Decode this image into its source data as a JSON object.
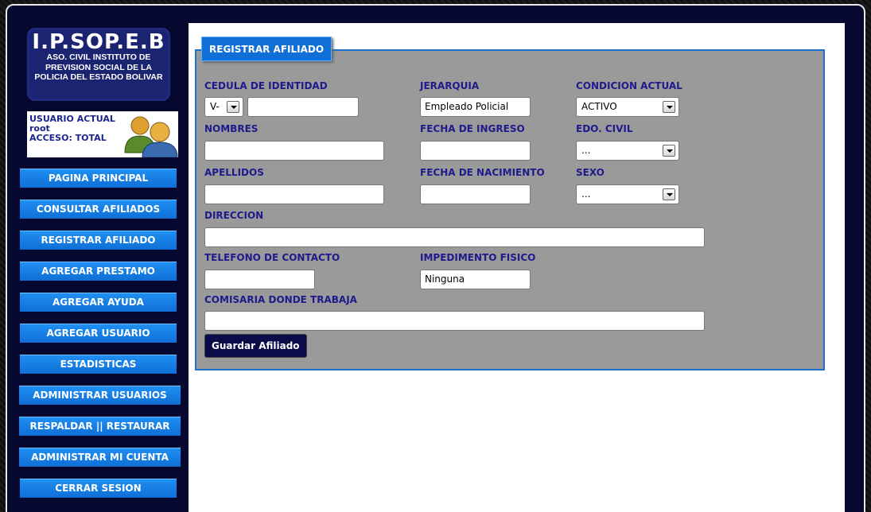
{
  "logo": {
    "title": "I.P.SOP.E.B",
    "line1": "ASO. CIVIL INSTITUTO DE",
    "line2": "PREVISION SOCIAL DE LA",
    "line3": "POLICIA DEL ESTADO BOLIVAR"
  },
  "user": {
    "label": "USUARIO ACTUAL",
    "name": "root",
    "access": "ACCESO: TOTAL"
  },
  "menu": [
    "PAGINA PRINCIPAL",
    "CONSULTAR AFILIADOS",
    "REGISTRAR AFILIADO",
    "AGREGAR PRESTAMO",
    "AGREGAR AYUDA",
    "AGREGAR USUARIO",
    "ESTADISTICAS",
    "ADMINISTRAR USUARIOS",
    "RESPALDAR || RESTAURAR",
    "ADMINISTRAR MI CUENTA",
    "CERRAR SESION"
  ],
  "form": {
    "title": "REGISTRAR AFILIADO",
    "cedula_label": "CEDULA DE IDENTIDAD",
    "cedula_prefix": "V-",
    "cedula_value": "",
    "jerarquia_label": "JERARQUIA",
    "jerarquia_value": "Empleado Policial",
    "condicion_label": "CONDICION ACTUAL",
    "condicion_value": "ACTIVO",
    "nombres_label": "NOMBRES",
    "fecha_ingreso_label": "FECHA DE INGRESO",
    "edo_civil_label": "EDO. CIVIL",
    "edo_civil_value": "...",
    "apellidos_label": "APELLIDOS",
    "fecha_nac_label": "FECHA DE NACIMIENTO",
    "sexo_label": "SEXO",
    "sexo_value": "...",
    "direccion_label": "DIRECCION",
    "telefono_label": "TELEFONO DE CONTACTO",
    "impedimento_label": "IMPEDIMENTO FISICO",
    "impedimento_value": "Ninguna",
    "comisaria_label": "COMISARIA DONDE TRABAJA",
    "save_label": "Guardar Afiliado"
  },
  "colors": {
    "frame_bg": "#070830",
    "menu_button": "#0f6fd6",
    "panel_bg": "#9a9a9a",
    "label_text": "#1f1a8c",
    "save_button": "#0b0b4a"
  }
}
